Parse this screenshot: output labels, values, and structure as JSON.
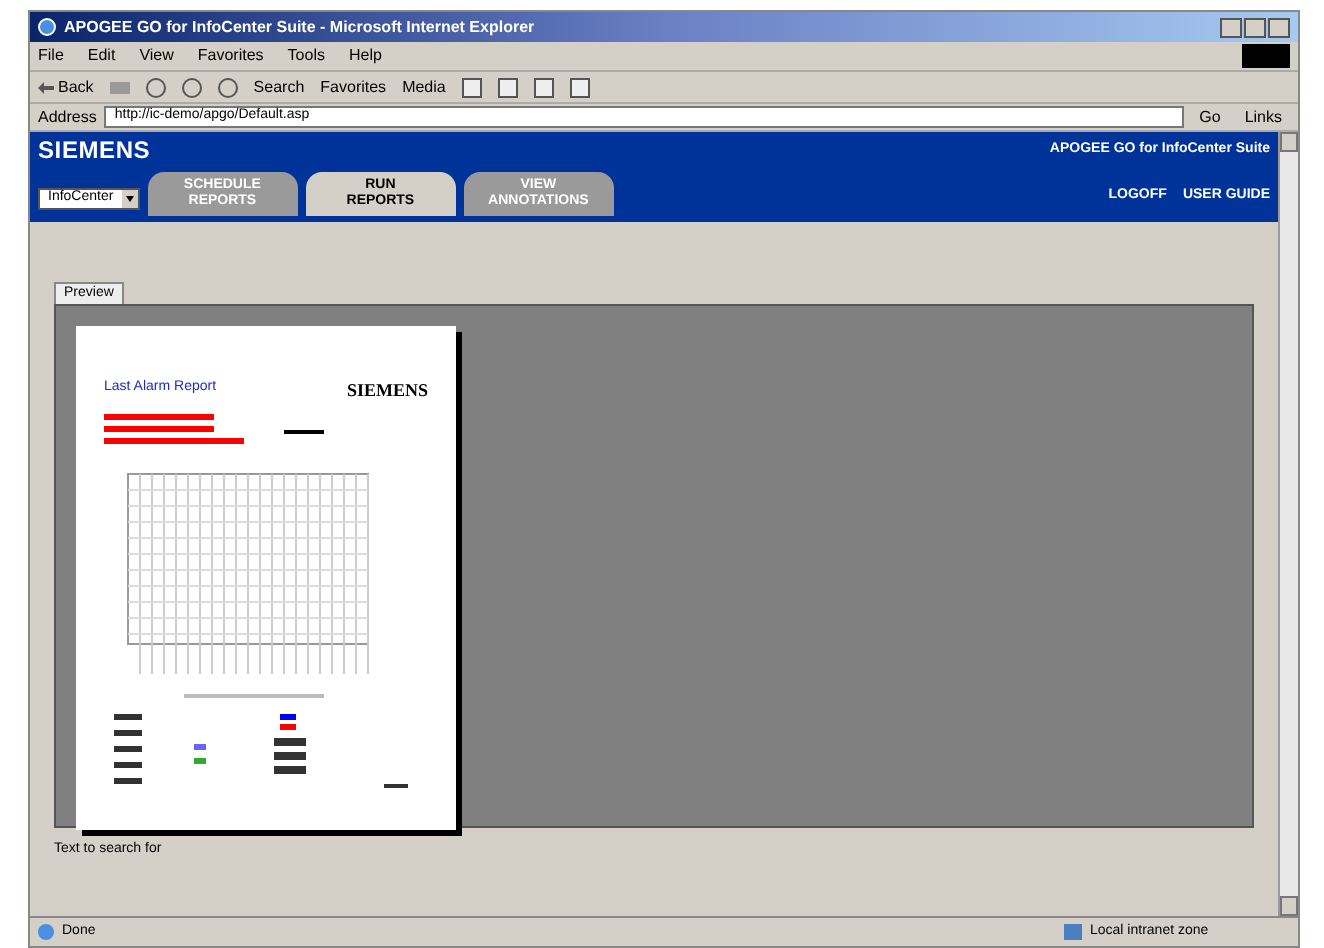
{
  "window": {
    "title": "APOGEE GO for InfoCenter Suite - Microsoft Internet Explorer"
  },
  "menu": [
    "File",
    "Edit",
    "View",
    "Favorites",
    "Tools",
    "Help"
  ],
  "toolbar": {
    "back": "Back",
    "search": "Search",
    "favorites": "Favorites",
    "media": "Media"
  },
  "address": {
    "label": "Address",
    "value": "http://ic-demo/apgo/Default.asp",
    "go": "Go",
    "links": "Links"
  },
  "header": {
    "logo": "SIEMENS",
    "product": "APOGEE GO for InfoCenter Suite",
    "dropdown": "InfoCenter",
    "tabs": [
      {
        "line1": "SCHEDULE",
        "line2": "REPORTS",
        "selected": false
      },
      {
        "line1": "RUN",
        "line2": "REPORTS",
        "selected": true
      },
      {
        "line1": "VIEW",
        "line2": "ANNOTATIONS",
        "selected": false
      }
    ],
    "links": [
      "LOGOFF",
      "USER GUIDE"
    ]
  },
  "preview": {
    "tab": "Preview",
    "report_title": "Last Alarm Report",
    "report_logo": "SIEMENS"
  },
  "search_label": "Text to search for",
  "status_bar": {
    "text": "Done",
    "zone": "Local intranet zone"
  }
}
